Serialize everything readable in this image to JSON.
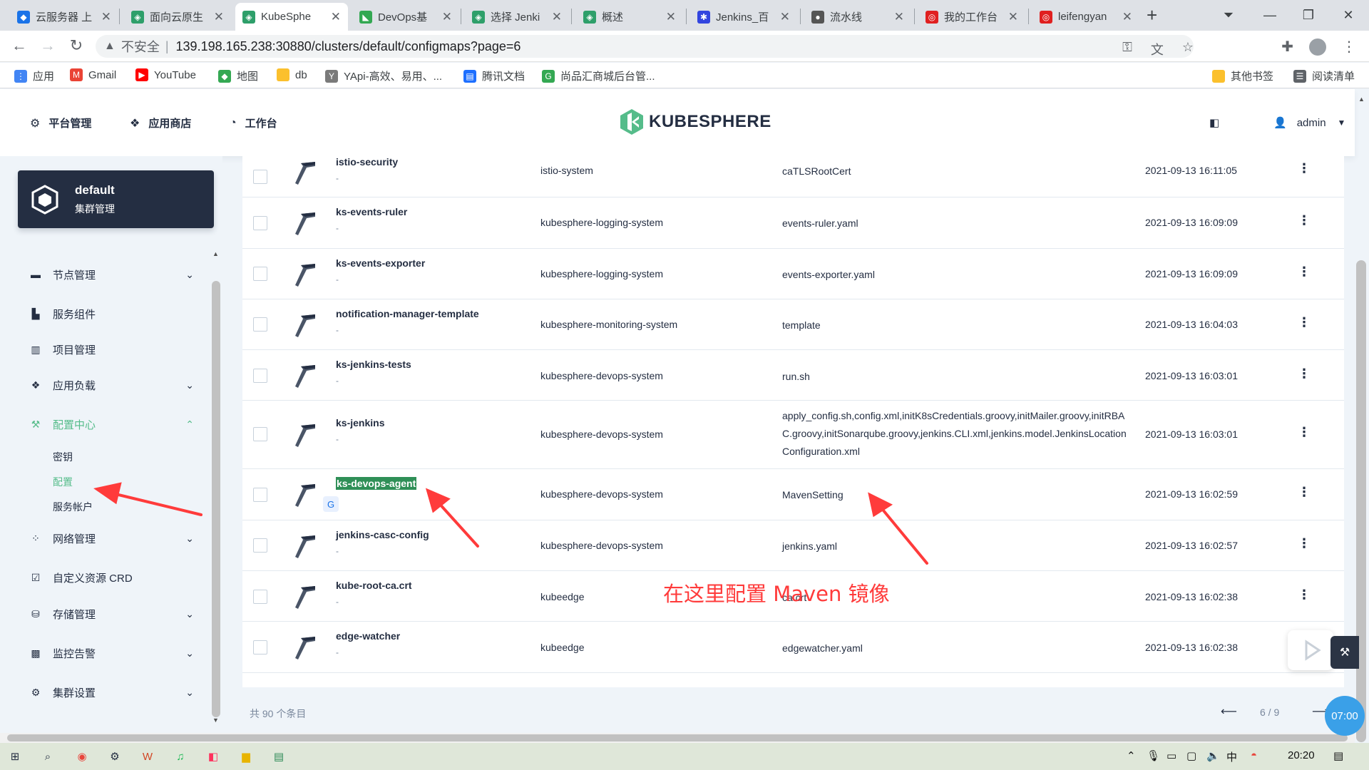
{
  "browser": {
    "tabs": [
      {
        "title": "云服务器 上",
        "color": "#1a73e8"
      },
      {
        "title": "面向云原生",
        "color": "#2e9f6a"
      },
      {
        "title": "KubeSphe",
        "color": "#2e9f6a"
      },
      {
        "title": "DevOps基",
        "color": "#33a852"
      },
      {
        "title": "选择 Jenki",
        "color": "#2e9f6a"
      },
      {
        "title": "概述",
        "color": "#2e9f6a"
      },
      {
        "title": "Jenkins_百",
        "color": "#3245df"
      },
      {
        "title": "流水线",
        "color": "#555555"
      },
      {
        "title": "我的工作台",
        "color": "#e02020"
      },
      {
        "title": "leifengyan",
        "color": "#e02020"
      }
    ],
    "close_glyph": "✕",
    "new_tab": "+",
    "address": {
      "insecure_label": "不安全",
      "separator": "|",
      "url": "139.198.165.238:30880/clusters/default/configmaps?page=6"
    },
    "bookmarks": [
      {
        "label": "应用",
        "color": "#4285f4"
      },
      {
        "label": "Gmail",
        "color": "#ea4335"
      },
      {
        "label": "YouTube",
        "color": "#ff0000"
      },
      {
        "label": "地图",
        "color": "#34a853"
      },
      {
        "label": "db",
        "color": "#fbc02d"
      },
      {
        "label": "YApi-高效、易用、...",
        "color": "#7a7a7a"
      },
      {
        "label": "腾讯文档",
        "color": "#1e6fff"
      },
      {
        "label": "尚品汇商城后台管...",
        "color": "#34a853"
      }
    ],
    "bookmarks_right": [
      {
        "label": "其他书签"
      },
      {
        "label": "阅读清单"
      }
    ]
  },
  "header": {
    "nav": [
      {
        "label": "平台管理",
        "icon": "gear-icon"
      },
      {
        "label": "应用商店",
        "icon": "cube-icon"
      },
      {
        "label": "工作台",
        "icon": "clock-icon"
      }
    ],
    "logo_text": "KUBESPHERE",
    "user": "admin"
  },
  "sidebar": {
    "cluster": {
      "name": "default",
      "subtitle": "集群管理"
    },
    "menu": [
      {
        "label": "节点管理",
        "icon": "server-icon",
        "expandable": true
      },
      {
        "label": "服务组件",
        "icon": "components-icon",
        "expandable": false
      },
      {
        "label": "项目管理",
        "icon": "project-icon",
        "expandable": false
      },
      {
        "label": "应用负载",
        "icon": "stack-icon",
        "expandable": true
      },
      {
        "label": "配置中心",
        "icon": "hammer-icon",
        "expandable": true,
        "active": true
      },
      {
        "label": "网络管理",
        "icon": "network-icon",
        "expandable": true
      },
      {
        "label": "自定义资源 CRD",
        "icon": "crd-icon",
        "expandable": false
      },
      {
        "label": "存储管理",
        "icon": "storage-icon",
        "expandable": true
      },
      {
        "label": "监控告警",
        "icon": "monitor-icon",
        "expandable": true
      },
      {
        "label": "集群设置",
        "icon": "settings-icon",
        "expandable": true
      }
    ],
    "config_sub": [
      {
        "label": "密钥",
        "active": false
      },
      {
        "label": "配置",
        "active": true
      },
      {
        "label": "服务帐户",
        "active": false
      }
    ]
  },
  "table": {
    "rows": [
      {
        "name": "istio-security",
        "desc": "-",
        "namespace": "istio-system",
        "keys": "caTLSRootCert",
        "created": "2021-09-13 16:11:05"
      },
      {
        "name": "ks-events-ruler",
        "desc": "-",
        "namespace": "kubesphere-logging-system",
        "keys": "events-ruler.yaml",
        "created": "2021-09-13 16:09:09"
      },
      {
        "name": "ks-events-exporter",
        "desc": "-",
        "namespace": "kubesphere-logging-system",
        "keys": "events-exporter.yaml",
        "created": "2021-09-13 16:09:09"
      },
      {
        "name": "notification-manager-template",
        "desc": "-",
        "namespace": "kubesphere-monitoring-system",
        "keys": "template",
        "created": "2021-09-13 16:04:03"
      },
      {
        "name": "ks-jenkins-tests",
        "desc": "-",
        "namespace": "kubesphere-devops-system",
        "keys": "run.sh",
        "created": "2021-09-13 16:03:01"
      },
      {
        "name": "ks-jenkins",
        "desc": "-",
        "namespace": "kubesphere-devops-system",
        "keys": "apply_config.sh,config.xml,initK8sCredentials.groovy,initMailer.groovy,initRBAC.groovy,initSonarqube.groovy,jenkins.CLI.xml,jenkins.model.JenkinsLocationConfiguration.xml",
        "created": "2021-09-13 16:03:01"
      },
      {
        "name": "ks-devops-agent",
        "desc": "",
        "namespace": "kubesphere-devops-system",
        "keys": "MavenSetting",
        "created": "2021-09-13 16:02:59",
        "highlighted": true
      },
      {
        "name": "jenkins-casc-config",
        "desc": "-",
        "namespace": "kubesphere-devops-system",
        "keys": "jenkins.yaml",
        "created": "2021-09-13 16:02:57"
      },
      {
        "name": "kube-root-ca.crt",
        "desc": "-",
        "namespace": "kubeedge",
        "keys": "ca.crt",
        "created": "2021-09-13 16:02:38"
      },
      {
        "name": "edge-watcher",
        "desc": "-",
        "namespace": "kubeedge",
        "keys": "edgewatcher.yaml",
        "created": "2021-09-13 16:02:38"
      }
    ],
    "total_text": "共 90 个条目",
    "page_text": "6 / 9",
    "more_glyph": "⋮"
  },
  "annotation": {
    "text": "在这里配置 Maven 镜像",
    "color": "#ff3b3b"
  },
  "overlay": {
    "timer": "07:00"
  },
  "taskbar": {
    "time": "20:20"
  },
  "colors": {
    "brand_green": "#55bc8a",
    "dark_navy": "#242e42",
    "highlight": "#2f8f57"
  }
}
